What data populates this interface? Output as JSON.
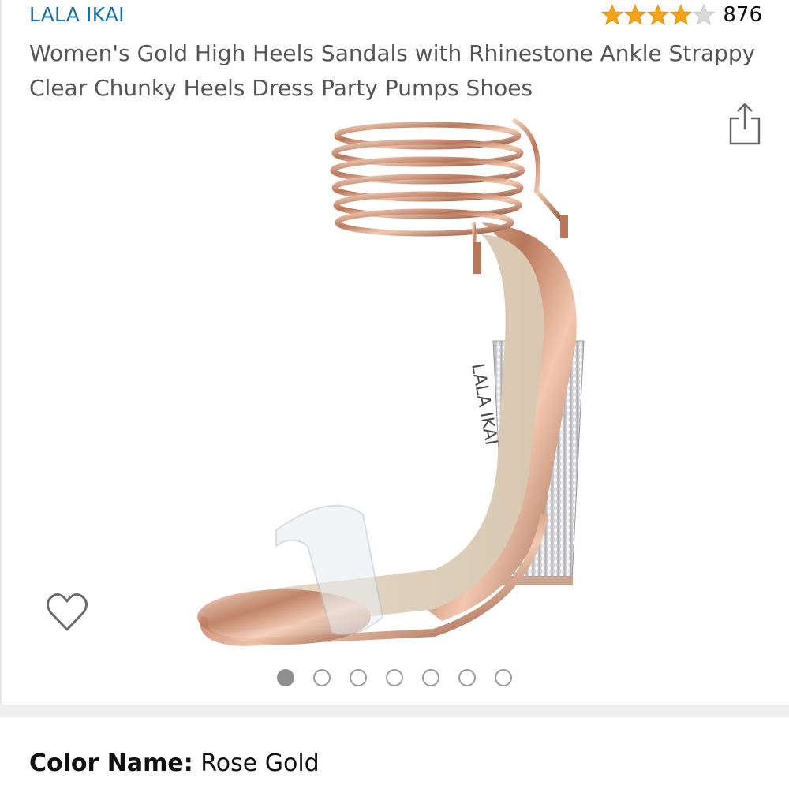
{
  "product": {
    "brand": "LALA IKAI",
    "rating": {
      "stars": 4,
      "max_stars": 5,
      "count": "876"
    },
    "title": "Women's Gold High Heels Sandals with Rhinestone Ankle Strappy Clear Chunky Heels Dress Party Pumps Shoes"
  },
  "gallery": {
    "active_index": 0,
    "image_count": 7
  },
  "icons": {
    "share": "share-icon",
    "wishlist": "heart-icon"
  },
  "variant": {
    "label": "Color Name:",
    "value": "Rose Gold"
  },
  "colors": {
    "brand_link": "#1a6fa8",
    "star": "#f7a21b",
    "title_text": "#555555"
  }
}
